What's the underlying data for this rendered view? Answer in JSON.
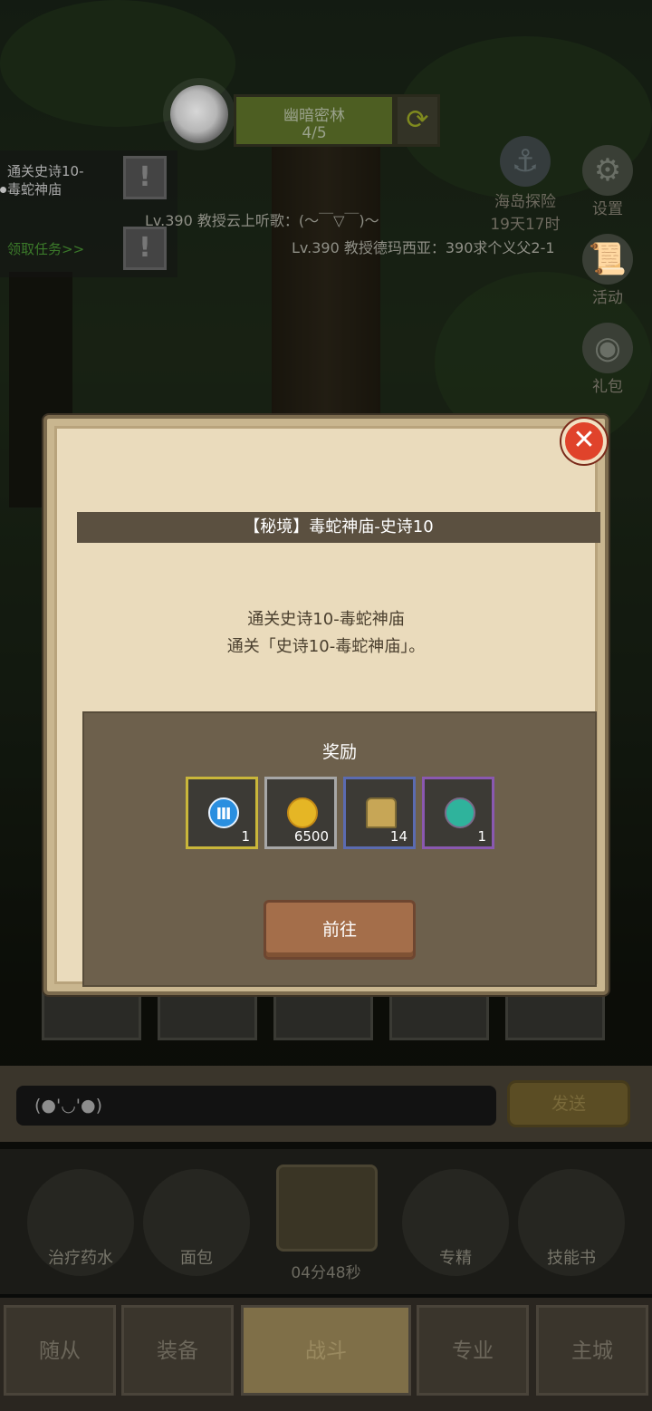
{
  "stage": {
    "name": "幽暗密林",
    "progress": "4/5"
  },
  "quest": {
    "line1": "通关史诗10-",
    "line2": "毒蛇神庙",
    "claim": "领取任务>>"
  },
  "chat_lines": [
    "Lv.390 教授云上听歌：(～￣▽￣)～",
    "Lv.390 教授德玛西亚：390求个义父2-1"
  ],
  "side": {
    "explore_label": "海岛探险",
    "explore_timer": "19天17时",
    "settings": "设置",
    "activity": "活动",
    "gift": "礼包"
  },
  "chat": {
    "input": "(●'◡'●)",
    "send": "发送"
  },
  "items": [
    {
      "label": "治疗药水"
    },
    {
      "label": "面包"
    },
    {
      "label": "专精"
    },
    {
      "label": "技能书"
    }
  ],
  "chest_timer": "04分48秒",
  "nav": [
    "随从",
    "装备",
    "战斗",
    "专业",
    "主城"
  ],
  "modal": {
    "title": "【秘境】毒蛇神庙-史诗10",
    "desc_line1": "通关史诗10-毒蛇神庙",
    "desc_line2": "通关「史诗10-毒蛇神庙」。",
    "reward_title": "奖励",
    "rewards": [
      {
        "icon": "tier-three-medal-icon",
        "symbol": "Ⅲ",
        "qty": "1",
        "border": "#c9b63a",
        "color": "#2a8fe0"
      },
      {
        "icon": "gold-coin-icon",
        "symbol": "",
        "qty": "6500",
        "border": "#a7a7a7",
        "color": "#e5b625"
      },
      {
        "icon": "helmet-icon",
        "symbol": "",
        "qty": "14",
        "border": "#5b6bb0",
        "color": "#c7a656"
      },
      {
        "icon": "gem-egg-icon",
        "symbol": "",
        "qty": "1",
        "border": "#8a58b0",
        "color": "#2fb39c"
      }
    ],
    "go_button": "前往",
    "close": "✕"
  }
}
